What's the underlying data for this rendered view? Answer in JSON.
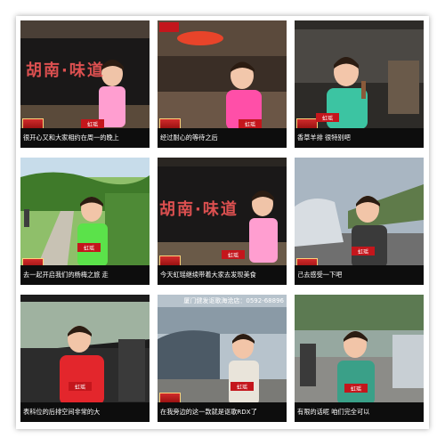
{
  "cells": [
    {
      "subtitle": "很开心又和大家相约在周一的晚上",
      "host_tag": "虹瑶",
      "sign": "胡南·味道"
    },
    {
      "subtitle": "经过耐心的等待之后",
      "host_tag": "虹瑶"
    },
    {
      "subtitle": "香草羊排  很特别吧",
      "host_tag": "虹瑶"
    },
    {
      "subtitle": "去一起开启我们的杨梅之旅  走",
      "host_tag": "虹瑶"
    },
    {
      "subtitle": "今天虹瑶继续带着大家去发现美食",
      "host_tag": "虹瑶",
      "sign": "胡南·味道"
    },
    {
      "subtitle": "己去感受一下吧",
      "host_tag": "虹瑶"
    },
    {
      "subtitle": "表科位的后排空间非常的大",
      "host_tag": "虹瑶"
    },
    {
      "subtitle": "在我旁边的这一款就是讴歌RDX了",
      "host_tag": "虹瑶",
      "banner": "厦门健发讴歌海沧店：0592-68896"
    },
    {
      "subtitle": "有限的话呢  咱们完全可以",
      "host_tag": "虹瑶"
    }
  ],
  "colors": {
    "station_red": "#c4161c",
    "subtitle_bg": "#0d0d0d"
  }
}
